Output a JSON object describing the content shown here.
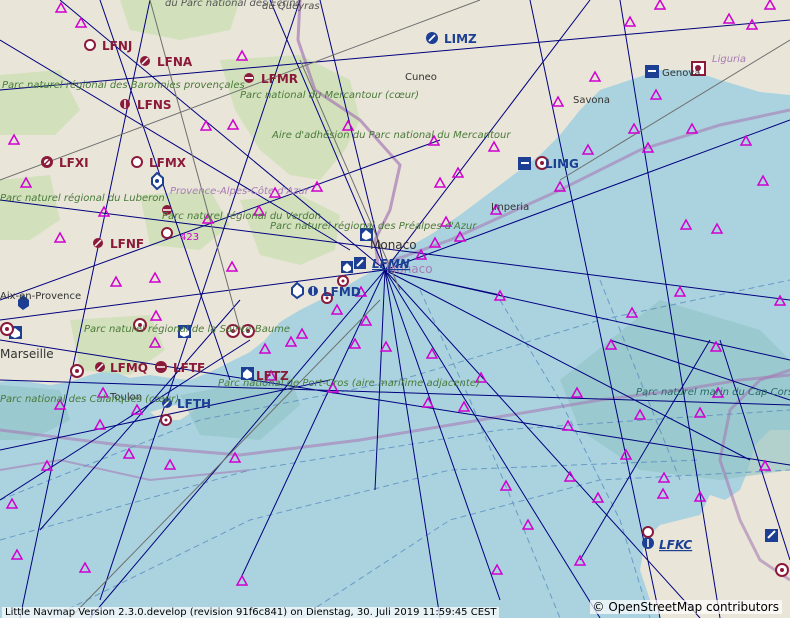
{
  "footer": {
    "version_text": "Little Navmap Version 2.3.0.develop (revision 91f6c841) on Dienstag, 30. Juli 2019 11:59:45 CEST",
    "attribution": "© OpenStreetMap contributors"
  },
  "colors": {
    "sea": "#aad3df",
    "land": "#e7e3d4",
    "park": "#c8dfb0",
    "border": "#a77bb5",
    "airway": "#00007f",
    "waypoint": "#d000d0",
    "airport": "#8b1a3a",
    "airport_major": "#1c3f94"
  },
  "airports": [
    {
      "code": "LFNJ",
      "icon": "airport-private-icon"
    },
    {
      "code": "LFNA",
      "icon": "airport-icon"
    },
    {
      "code": "LFMR",
      "icon": "airport-closed-icon"
    },
    {
      "code": "LFNS",
      "icon": "airport-icon"
    },
    {
      "code": "LFXI",
      "icon": "airport-icon"
    },
    {
      "code": "LFMX",
      "icon": "airport-private-icon"
    },
    {
      "code": "LFNF",
      "icon": "airport-icon"
    },
    {
      "code": "LFMN",
      "icon": "airport-towered-icon"
    },
    {
      "code": "LFMD",
      "icon": "airport-icon"
    },
    {
      "code": "LFMQ",
      "icon": "airport-icon"
    },
    {
      "code": "LFTF",
      "icon": "airport-icon"
    },
    {
      "code": "LFTH",
      "icon": "airport-military-icon"
    },
    {
      "code": "LFTZ",
      "icon": "airport-icon"
    },
    {
      "code": "LIMZ",
      "icon": "airport-towered-icon"
    },
    {
      "code": "LIMG",
      "icon": "airport-icon"
    },
    {
      "code": "LFKC",
      "icon": "airport-towered-icon"
    }
  ],
  "places": [
    {
      "name": "du Parc national des Écrins"
    },
    {
      "name": "du Queyras"
    },
    {
      "name": "Cuneo"
    },
    {
      "name": "Savona"
    },
    {
      "name": "Liguria"
    },
    {
      "name": "Genova"
    },
    {
      "name": "Parc naturel régional des Baronnies provençales"
    },
    {
      "name": "Parc national du Mercantour (cœur)"
    },
    {
      "name": "Aire d'adhésion du Parc national du Mercantour"
    },
    {
      "name": "Provence-Alpes-Côte d'Azur"
    },
    {
      "name": "Parc naturel régional du Verdon"
    },
    {
      "name": "Parc naturel régional du Luberon"
    },
    {
      "name": "Parc naturel régional des Préalpes d'Azur"
    },
    {
      "name": "Monaco"
    },
    {
      "name": "Imperia"
    },
    {
      "name": "Aix-en-Provence"
    },
    {
      "name": "Marseille"
    },
    {
      "name": "Parc naturel régional de la Sainte-Baume"
    },
    {
      "name": "Toulon"
    },
    {
      "name": "Parc national de Port-Cros (aire maritime adjacente)"
    },
    {
      "name": "Parc national des Calanques (cœur)"
    },
    {
      "name": "Parc naturel marin du Cap Corse et de l'Agriate"
    },
    {
      "name": "423"
    }
  ]
}
